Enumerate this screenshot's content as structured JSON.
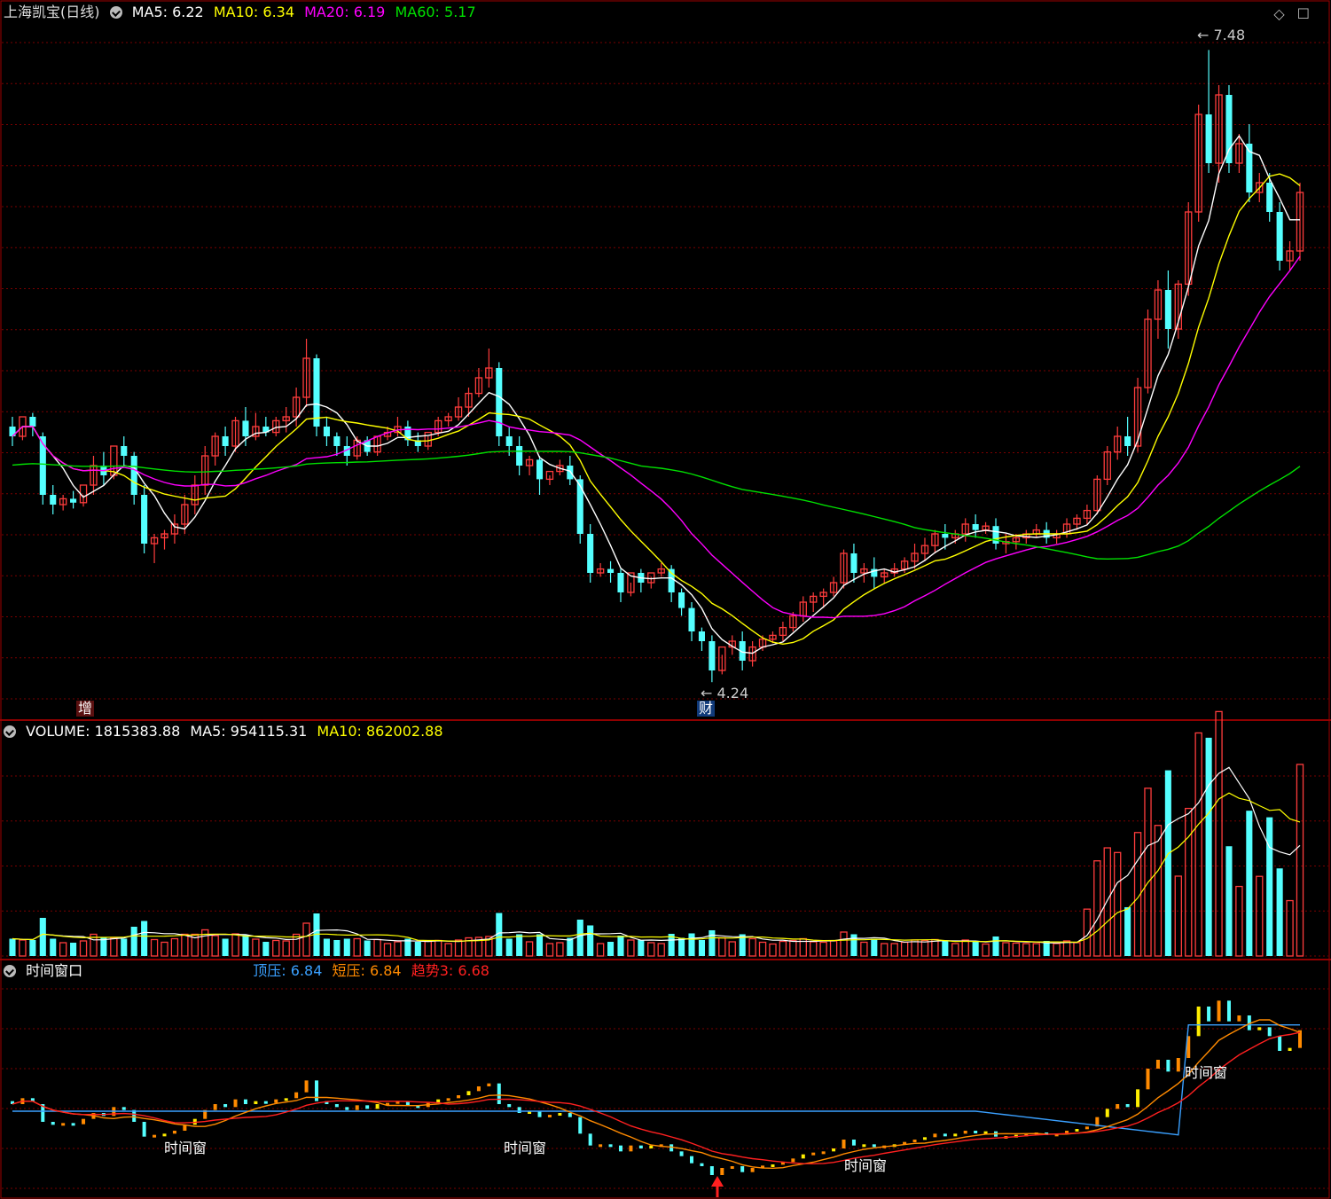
{
  "panel1": {
    "title": "上海凯宝(日线)",
    "ma5_label": "MA5: 6.22",
    "ma10_label": "MA10: 6.34",
    "ma20_label": "MA20: 6.19",
    "ma60_label": "MA60: 5.17",
    "high_label": "7.48",
    "low_label": "4.24",
    "tag_left": "增",
    "tag_mid": "财"
  },
  "panel2": {
    "volume_label": "VOLUME: 1815383.88",
    "ma5_label": "MA5: 954115.31",
    "ma10_label": "MA10: 862002.88"
  },
  "panel3": {
    "title": "时间窗口",
    "top_label": "顶压: 6.84",
    "short_label": "短压: 6.84",
    "trend_label": "趋势3: 6.68",
    "window_text": "时间窗"
  },
  "colors": {
    "up": "#ff3c3c",
    "down": "#54ffff",
    "ma5": "#ffffff",
    "ma10": "#ffff00",
    "ma20": "#ff00ff",
    "ma60": "#00e000",
    "grid": "#7a0000",
    "top_press": "#3aa0ff",
    "short_press": "#ff8a00",
    "trend": "#ff2020"
  },
  "chart_data": {
    "type": "candlestick",
    "ohlc": [
      [
        5.55,
        5.6,
        5.5,
        5.45
      ],
      [
        5.5,
        5.55,
        5.6,
        5.48
      ],
      [
        5.6,
        5.62,
        5.55,
        5.5
      ],
      [
        5.5,
        5.52,
        5.2,
        5.15
      ],
      [
        5.2,
        5.25,
        5.15,
        5.1
      ],
      [
        5.15,
        5.2,
        5.18,
        5.12
      ],
      [
        5.18,
        5.22,
        5.16,
        5.13
      ],
      [
        5.16,
        5.2,
        5.25,
        5.14
      ],
      [
        5.25,
        5.4,
        5.35,
        5.2
      ],
      [
        5.35,
        5.42,
        5.3,
        5.25
      ],
      [
        5.3,
        5.35,
        5.45,
        5.28
      ],
      [
        5.45,
        5.5,
        5.4,
        5.35
      ],
      [
        5.4,
        5.42,
        5.2,
        5.15
      ],
      [
        5.2,
        5.25,
        4.95,
        4.9
      ],
      [
        4.95,
        5.0,
        4.98,
        4.85
      ],
      [
        4.98,
        5.02,
        5.0,
        4.92
      ],
      [
        5.0,
        5.1,
        5.05,
        4.95
      ],
      [
        5.05,
        5.2,
        5.15,
        5.0
      ],
      [
        5.15,
        5.3,
        5.25,
        5.1
      ],
      [
        5.25,
        5.45,
        5.4,
        5.2
      ],
      [
        5.4,
        5.52,
        5.5,
        5.35
      ],
      [
        5.5,
        5.55,
        5.45,
        5.4
      ],
      [
        5.45,
        5.6,
        5.58,
        5.42
      ],
      [
        5.58,
        5.65,
        5.5,
        5.45
      ],
      [
        5.5,
        5.62,
        5.55,
        5.48
      ],
      [
        5.55,
        5.6,
        5.52,
        5.5
      ],
      [
        5.52,
        5.6,
        5.58,
        5.5
      ],
      [
        5.58,
        5.65,
        5.6,
        5.52
      ],
      [
        5.6,
        5.75,
        5.7,
        5.55
      ],
      [
        5.7,
        6.0,
        5.9,
        5.65
      ],
      [
        5.9,
        5.92,
        5.55,
        5.5
      ],
      [
        5.55,
        5.6,
        5.5,
        5.45
      ],
      [
        5.5,
        5.52,
        5.45,
        5.4
      ],
      [
        5.45,
        5.5,
        5.4,
        5.35
      ],
      [
        5.4,
        5.5,
        5.48,
        5.38
      ],
      [
        5.48,
        5.5,
        5.42,
        5.4
      ],
      [
        5.42,
        5.5,
        5.5,
        5.4
      ],
      [
        5.5,
        5.55,
        5.52,
        5.48
      ],
      [
        5.52,
        5.6,
        5.55,
        5.5
      ],
      [
        5.55,
        5.58,
        5.48,
        5.45
      ],
      [
        5.48,
        5.52,
        5.45,
        5.42
      ],
      [
        5.45,
        5.5,
        5.52,
        5.43
      ],
      [
        5.52,
        5.6,
        5.58,
        5.5
      ],
      [
        5.58,
        5.62,
        5.6,
        5.55
      ],
      [
        5.6,
        5.7,
        5.65,
        5.58
      ],
      [
        5.65,
        5.75,
        5.72,
        5.6
      ],
      [
        5.72,
        5.85,
        5.8,
        5.7
      ],
      [
        5.8,
        5.95,
        5.85,
        5.75
      ],
      [
        5.85,
        5.88,
        5.5,
        5.45
      ],
      [
        5.5,
        5.55,
        5.45,
        5.4
      ],
      [
        5.45,
        5.5,
        5.35,
        5.3
      ],
      [
        5.35,
        5.4,
        5.38,
        5.3
      ],
      [
        5.38,
        5.4,
        5.28,
        5.2
      ],
      [
        5.28,
        5.3,
        5.32,
        5.25
      ],
      [
        5.32,
        5.38,
        5.35,
        5.3
      ],
      [
        5.35,
        5.4,
        5.28,
        5.25
      ],
      [
        5.28,
        5.3,
        5.0,
        4.95
      ],
      [
        5.0,
        5.05,
        4.8,
        4.75
      ],
      [
        4.8,
        4.85,
        4.82,
        4.78
      ],
      [
        4.82,
        4.86,
        4.8,
        4.75
      ],
      [
        4.8,
        4.82,
        4.7,
        4.65
      ],
      [
        4.7,
        4.75,
        4.8,
        4.68
      ],
      [
        4.8,
        4.82,
        4.75,
        4.7
      ],
      [
        4.75,
        4.78,
        4.8,
        4.72
      ],
      [
        4.8,
        4.85,
        4.82,
        4.78
      ],
      [
        4.82,
        4.84,
        4.7,
        4.65
      ],
      [
        4.7,
        4.72,
        4.62,
        4.58
      ],
      [
        4.62,
        4.65,
        4.5,
        4.45
      ],
      [
        4.5,
        4.52,
        4.45,
        4.4
      ],
      [
        4.45,
        4.48,
        4.3,
        4.24
      ],
      [
        4.3,
        4.38,
        4.42,
        4.28
      ],
      [
        4.42,
        4.48,
        4.45,
        4.38
      ],
      [
        4.45,
        4.5,
        4.35,
        4.3
      ],
      [
        4.35,
        4.45,
        4.42,
        4.32
      ],
      [
        4.42,
        4.48,
        4.46,
        4.4
      ],
      [
        4.46,
        4.5,
        4.48,
        4.44
      ],
      [
        4.48,
        4.55,
        4.52,
        4.45
      ],
      [
        4.52,
        4.6,
        4.58,
        4.5
      ],
      [
        4.58,
        4.68,
        4.65,
        4.55
      ],
      [
        4.65,
        4.7,
        4.68,
        4.6
      ],
      [
        4.68,
        4.72,
        4.7,
        4.62
      ],
      [
        4.7,
        4.78,
        4.75,
        4.68
      ],
      [
        4.75,
        4.92,
        4.9,
        4.72
      ],
      [
        4.9,
        4.95,
        4.8,
        4.75
      ],
      [
        4.8,
        4.85,
        4.82,
        4.75
      ],
      [
        4.82,
        4.88,
        4.78,
        4.72
      ],
      [
        4.78,
        4.82,
        4.8,
        4.75
      ],
      [
        4.8,
        4.85,
        4.82,
        4.78
      ],
      [
        4.82,
        4.88,
        4.86,
        4.8
      ],
      [
        4.86,
        4.95,
        4.9,
        4.82
      ],
      [
        4.9,
        4.98,
        4.94,
        4.86
      ],
      [
        4.94,
        5.02,
        5.0,
        4.9
      ],
      [
        5.0,
        5.05,
        4.98,
        4.92
      ],
      [
        4.98,
        5.02,
        5.0,
        4.95
      ],
      [
        5.0,
        5.08,
        5.05,
        4.96
      ],
      [
        5.05,
        5.1,
        5.02,
        4.98
      ],
      [
        5.02,
        5.06,
        5.04,
        5.0
      ],
      [
        5.04,
        5.08,
        4.95,
        4.92
      ],
      [
        4.95,
        5.0,
        4.96,
        4.9
      ],
      [
        4.96,
        5.0,
        4.98,
        4.92
      ],
      [
        4.98,
        5.02,
        5.0,
        4.95
      ],
      [
        5.0,
        5.05,
        5.02,
        4.98
      ],
      [
        5.02,
        5.06,
        4.98,
        4.95
      ],
      [
        4.98,
        5.02,
        5.0,
        4.95
      ],
      [
        5.0,
        5.08,
        5.05,
        4.98
      ],
      [
        5.05,
        5.1,
        5.08,
        5.02
      ],
      [
        5.08,
        5.15,
        5.12,
        5.05
      ],
      [
        5.12,
        5.3,
        5.28,
        5.1
      ],
      [
        5.28,
        5.45,
        5.42,
        5.25
      ],
      [
        5.42,
        5.55,
        5.5,
        5.38
      ],
      [
        5.5,
        5.6,
        5.45,
        5.4
      ],
      [
        5.45,
        5.8,
        5.75,
        5.42
      ],
      [
        5.75,
        6.15,
        6.1,
        5.72
      ],
      [
        6.1,
        6.3,
        6.25,
        6.0
      ],
      [
        6.25,
        6.35,
        6.05,
        5.95
      ],
      [
        6.05,
        6.3,
        6.28,
        6.0
      ],
      [
        6.28,
        6.7,
        6.65,
        6.22
      ],
      [
        6.65,
        7.2,
        7.15,
        6.6
      ],
      [
        7.15,
        7.48,
        6.9,
        6.85
      ],
      [
        6.9,
        7.3,
        7.25,
        6.8
      ],
      [
        7.25,
        7.3,
        6.9,
        6.85
      ],
      [
        6.9,
        7.05,
        7.0,
        6.85
      ],
      [
        7.0,
        7.1,
        6.75,
        6.7
      ],
      [
        6.75,
        6.85,
        6.8,
        6.7
      ],
      [
        6.8,
        6.85,
        6.65,
        6.6
      ],
      [
        6.65,
        6.7,
        6.4,
        6.35
      ],
      [
        6.4,
        6.5,
        6.45,
        6.35
      ],
      [
        6.45,
        6.8,
        6.75,
        6.4
      ]
    ],
    "price_range": [
      4.1,
      7.6
    ],
    "high": 7.48,
    "low": 4.24,
    "ma5_last": 6.22,
    "ma10_last": 6.34,
    "ma20_last": 6.19,
    "ma60_last": 5.17,
    "volume_last": 1815383.88,
    "volume_ma5_last": 954115.31,
    "volume_ma10_last": 862002.88,
    "top_press_last": 6.84,
    "short_press_last": 6.84,
    "trend3_last": 6.68
  }
}
